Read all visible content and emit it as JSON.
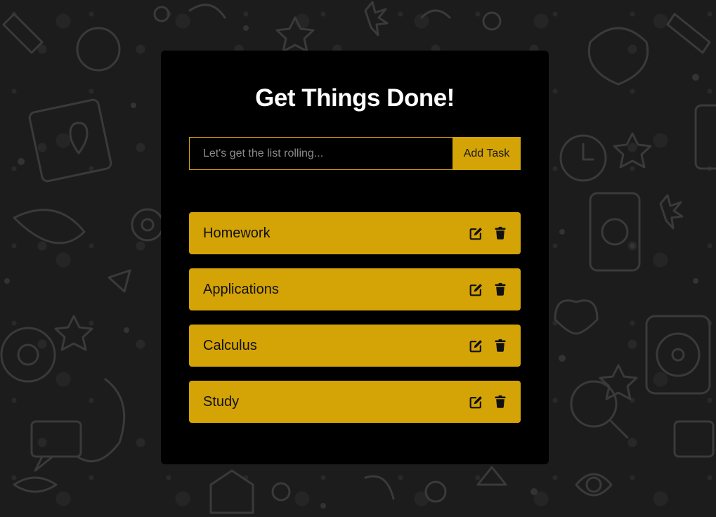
{
  "header": {
    "title": "Get Things Done!"
  },
  "form": {
    "input_value": "",
    "input_placeholder": "Let's get the list rolling...",
    "add_button_label": "Add Task"
  },
  "tasks": [
    {
      "label": "Homework",
      "icons": [
        "edit-icon",
        "trash-icon"
      ]
    },
    {
      "label": "Applications",
      "icons": [
        "edit-icon",
        "trash-icon"
      ]
    },
    {
      "label": "Calculus",
      "icons": [
        "edit-icon",
        "trash-icon"
      ]
    },
    {
      "label": "Study",
      "icons": [
        "edit-icon",
        "trash-icon"
      ]
    }
  ],
  "colors": {
    "background": "#1c1c1c",
    "card": "#000000",
    "accent": "#d4a305",
    "title": "#ffffff",
    "task_text": "#111111",
    "placeholder": "#8a8a8a"
  }
}
